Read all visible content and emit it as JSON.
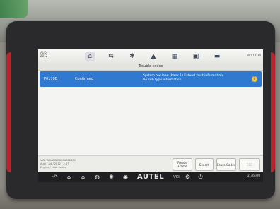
{
  "topbar": {
    "vehicle_info": [
      "AUDI",
      "2012"
    ],
    "icons": [
      "home-icon",
      "vehicle-icon",
      "settings-icon",
      "car-icon",
      "apps-icon",
      "save-icon",
      "message-icon"
    ],
    "status": "VCI 12:34"
  },
  "title": "Trouble codes",
  "dtc": {
    "code": "P0170B",
    "status": "Confirmed",
    "description_line1": "System too lean (bank 1) Extend fault information",
    "description_line2": "No sub type information",
    "help_label": "?"
  },
  "bottombar": {
    "info_lines": [
      "VIN: WAUZZZ8K0CA000000",
      "Audi / A4 / 2012 / 2.0T",
      "Engine / Fault codes"
    ],
    "buttons": {
      "freeze_frame": "Freeze Frame",
      "search": "Search",
      "erase_codes": "Erase Codes",
      "exit": "ESC"
    }
  },
  "navbar": {
    "brand": "AUTEL",
    "vci": "VCI",
    "status_right": "2:36 PM"
  }
}
